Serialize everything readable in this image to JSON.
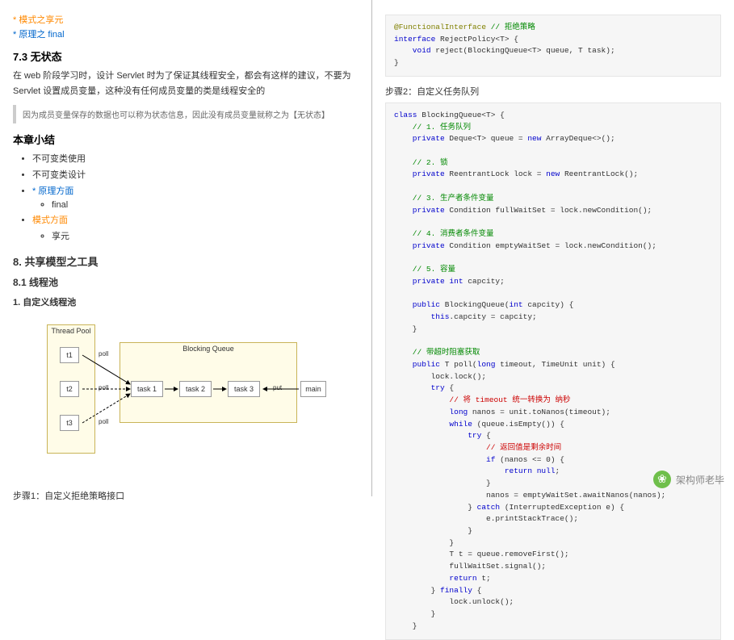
{
  "left": {
    "link_flyweight": "* 模式之享元",
    "link_final": "* 原理之 final",
    "h_73": "7.3 无状态",
    "para_73": "在 web 阶段学习时，设计 Servlet 时为了保证其线程安全，都会有这样的建议，不要为 Servlet 设置成员变量，这种没有任何成员变量的类是线程安全的",
    "quote": "因为成员变量保存的数据也可以称为状态信息，因此没有成员变量就称之为【无状态】",
    "h_summary": "本章小结",
    "bullets": {
      "b1": "不可变类使用",
      "b2": "不可变类设计",
      "b3": "* 原理方面",
      "b3a": "final",
      "b4": "模式方面",
      "b4a": "享元"
    },
    "h_8": "8. 共享模型之工具",
    "h_81": "8.1 线程池",
    "h_811": "1. 自定义线程池",
    "diagram": {
      "pool": "Thread Pool",
      "t1": "t1",
      "t2": "t2",
      "t3": "t3",
      "bq": "Blocking Queue",
      "task1": "task 1",
      "task2": "task 2",
      "task3": "task 3",
      "main": "main",
      "poll": "poll",
      "put": "put"
    },
    "step1": "步骤1：自定义拒绝策略接口"
  },
  "right": {
    "code1": {
      "l1a": "@FunctionalInterface",
      "l1b": " // 拒绝策略",
      "l2a": "interface",
      "l2b": " RejectPolicy<T> {",
      "l3a": "    void",
      "l3b": " reject(BlockingQueue<T> queue, T task);",
      "l4": "}"
    },
    "step2": "步骤2：自定义任务队列",
    "code2": {
      "l1a": "class",
      "l1b": " BlockingQueue<T> {",
      "c1": "    // 1. 任务队列",
      "l2a": "    private",
      "l2b": " Deque<T> queue = ",
      "l2c": "new",
      "l2d": " ArrayDeque<>();",
      "gap": "",
      "c2": "    // 2. 锁",
      "l3a": "    private",
      "l3b": " ReentrantLock lock = ",
      "l3c": "new",
      "l3d": " ReentrantLock();",
      "c3": "    // 3. 生产者条件变量",
      "l4a": "    private",
      "l4b": " Condition fullWaitSet = lock.newCondition();",
      "c4": "    // 4. 消费者条件变量",
      "l5a": "    private",
      "l5b": " Condition emptyWaitSet = lock.newCondition();",
      "c5": "    // 5. 容量",
      "l6a": "    private int",
      "l6b": " capcity;",
      "l7a": "    public",
      "l7b": " BlockingQueue(",
      "l7c": "int",
      "l7d": " capcity) {",
      "l8a": "        this",
      "l8b": ".capcity = capcity;",
      "l9": "    }",
      "c6": "    // 带超时阻塞获取",
      "l10a": "    public",
      "l10b": " T poll(",
      "l10c": "long",
      "l10d": " timeout, TimeUnit unit) {",
      "l11": "        lock.lock();",
      "l12a": "        try",
      "l12b": " {",
      "c7": "            // 将 timeout 统一转换为 纳秒",
      "l13a": "            long",
      "l13b": " nanos = unit.toNanos(timeout);",
      "l14a": "            while",
      "l14b": " (queue.isEmpty()) {",
      "l15a": "                try",
      "l15b": " {",
      "c8": "                    // 返回值是剩余时间",
      "l16a": "                    if",
      "l16b": " (nanos <= ",
      "l16c": "0",
      "l16d": ") {",
      "l17a": "                        return null",
      "l17b": ";",
      "l18": "                    }",
      "l19": "                    nanos = emptyWaitSet.awaitNanos(nanos);",
      "l20a": "                } ",
      "l20b": "catch",
      "l20c": " (InterruptedException e) {",
      "l21": "                    e.printStackTrace();",
      "l22": "                }",
      "l23": "            }",
      "l24": "            T t = queue.removeFirst();",
      "l25": "            fullWaitSet.signal();",
      "l26a": "            return",
      "l26b": " t;",
      "l27a": "        } ",
      "l27b": "finally",
      "l27c": " {",
      "l28": "            lock.unlock();",
      "l29": "        }",
      "l30": "    }"
    },
    "watermark": "架构师老毕"
  }
}
